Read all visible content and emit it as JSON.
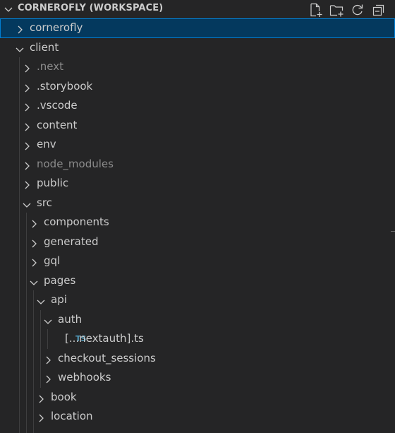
{
  "header": {
    "title": "CORNEROFLY (WORKSPACE)",
    "actions": [
      {
        "name": "new-file-icon"
      },
      {
        "name": "new-folder-icon"
      },
      {
        "name": "refresh-icon"
      },
      {
        "name": "collapse-all-icon"
      }
    ]
  },
  "tree": [
    {
      "label": "cornerofly",
      "depth": 0,
      "type": "folder",
      "expanded": false,
      "selected": true
    },
    {
      "label": "client",
      "depth": 0,
      "type": "folder",
      "expanded": true
    },
    {
      "label": ".next",
      "depth": 1,
      "type": "folder",
      "expanded": false,
      "dim": true
    },
    {
      "label": ".storybook",
      "depth": 1,
      "type": "folder",
      "expanded": false
    },
    {
      "label": ".vscode",
      "depth": 1,
      "type": "folder",
      "expanded": false
    },
    {
      "label": "content",
      "depth": 1,
      "type": "folder",
      "expanded": false
    },
    {
      "label": "env",
      "depth": 1,
      "type": "folder",
      "expanded": false
    },
    {
      "label": "node_modules",
      "depth": 1,
      "type": "folder",
      "expanded": false,
      "dim": true
    },
    {
      "label": "public",
      "depth": 1,
      "type": "folder",
      "expanded": false
    },
    {
      "label": "src",
      "depth": 1,
      "type": "folder",
      "expanded": true
    },
    {
      "label": "components",
      "depth": 2,
      "type": "folder",
      "expanded": false
    },
    {
      "label": "generated",
      "depth": 2,
      "type": "folder",
      "expanded": false
    },
    {
      "label": "gql",
      "depth": 2,
      "type": "folder",
      "expanded": false
    },
    {
      "label": "pages",
      "depth": 2,
      "type": "folder",
      "expanded": true
    },
    {
      "label": "api",
      "depth": 3,
      "type": "folder",
      "expanded": true
    },
    {
      "label": "auth",
      "depth": 4,
      "type": "folder",
      "expanded": true
    },
    {
      "label": "[...nextauth].ts",
      "depth": 4,
      "type": "file",
      "badge": "TS"
    },
    {
      "label": "checkout_sessions",
      "depth": 4,
      "type": "folder",
      "expanded": false
    },
    {
      "label": "webhooks",
      "depth": 4,
      "type": "folder",
      "expanded": false
    },
    {
      "label": "book",
      "depth": 3,
      "type": "folder",
      "expanded": false
    },
    {
      "label": "location",
      "depth": 3,
      "type": "folder",
      "expanded": false
    },
    {
      "label": "",
      "depth": 3,
      "type": "folder",
      "expanded": false
    }
  ]
}
